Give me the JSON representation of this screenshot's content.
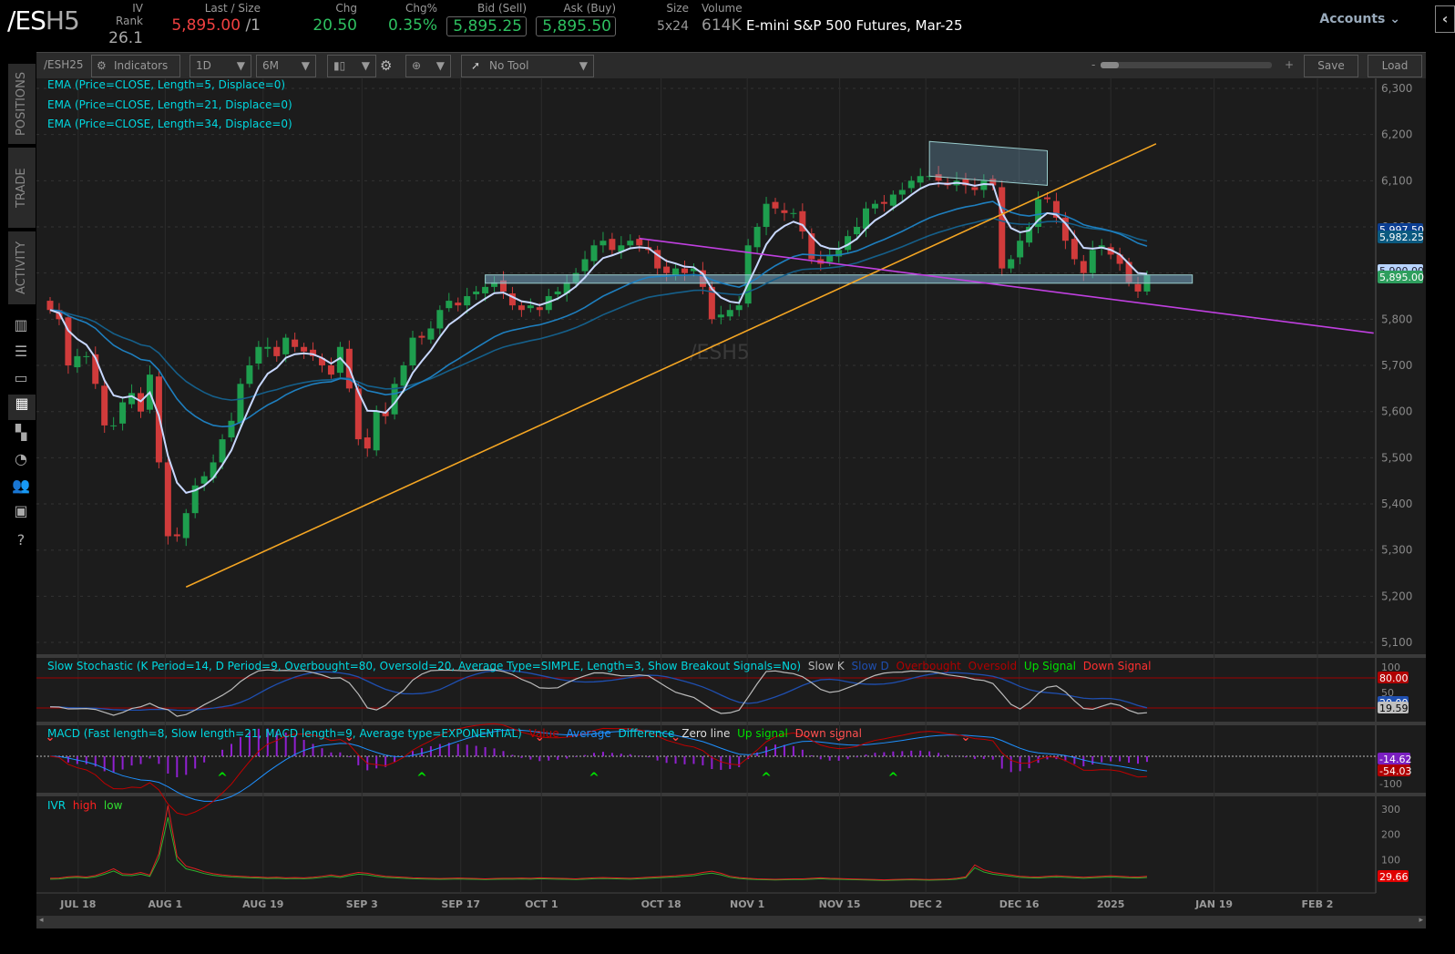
{
  "header": {
    "symbol_main": "/ES",
    "symbol_suffix": "H5",
    "iv_rank_label": "IV Rank",
    "iv_rank": "26.1",
    "last_label": "Last / Size",
    "last": "5,895.00",
    "last_size": "/1",
    "chg_label": "Chg",
    "chg": "20.50",
    "chgpct_label": "Chg%",
    "chgpct": "0.35%",
    "bid_label": "Bid (Sell)",
    "bid": "5,895.25",
    "ask_label": "Ask (Buy)",
    "ask": "5,895.50",
    "size_label": "Size",
    "size": "5x24",
    "volume_label": "Volume",
    "volume": "614K",
    "description": "E-mini S&P 500 Futures, Mar-25",
    "accounts": "Accounts"
  },
  "sidebar": {
    "tabs": [
      "POSITIONS",
      "TRADE",
      "ACTIVITY"
    ]
  },
  "toolbar": {
    "symbol": "/ESH25",
    "indicators": "Indicators",
    "aggregation": "1D",
    "timeframe": "6M",
    "drawing_tool": "No Tool",
    "zoom_minus": "-",
    "zoom_plus": "+",
    "save": "Save",
    "load": "Load",
    "zoom_level": 0.05
  },
  "colors": {
    "up": "#1e9e4e",
    "down": "#d03b3b",
    "ema5": "#c8d8ff",
    "ema21": "#1e7fbf",
    "ema34": "#155f8a",
    "trend": "#f5a623",
    "resistance": "#c040e0",
    "zone": "#7fb3d5"
  },
  "legends": {
    "ema": [
      "EMA (Price=CLOSE, Length=5, Displace=0)",
      "EMA (Price=CLOSE, Length=21, Displace=0)",
      "EMA (Price=CLOSE, Length=34, Displace=0)"
    ],
    "stoch": {
      "title": "Slow Stochastic (K Period=14, D Period=9, Overbought=80, Oversold=20, Average Type=SIMPLE, Length=3, Show Breakout Signals=No)",
      "items": [
        {
          "t": "Slow K",
          "c": "#bbbbbb"
        },
        {
          "t": "Slow D",
          "c": "#1f4fb0"
        },
        {
          "t": "Overbought",
          "c": "#b00000"
        },
        {
          "t": "Oversold",
          "c": "#b00000"
        },
        {
          "t": "Up Signal",
          "c": "#00e000"
        },
        {
          "t": "Down Signal",
          "c": "#ff3030"
        }
      ]
    },
    "macd": {
      "title": "MACD (Fast length=8, Slow length=21, MACD length=9, Average type=EXPONENTIAL)",
      "items": [
        {
          "t": "Value",
          "c": "#c00000"
        },
        {
          "t": "Average",
          "c": "#1e90ff"
        },
        {
          "t": "Difference",
          "c": "#00d8e0"
        },
        {
          "t": "Zero line",
          "c": "#dddddd"
        },
        {
          "t": "Up signal",
          "c": "#00e000"
        },
        {
          "t": "Down signal",
          "c": "#ff5050"
        }
      ]
    },
    "ivr": {
      "title": "IVR",
      "items": [
        {
          "t": "high",
          "c": "#ff2020"
        },
        {
          "t": "low",
          "c": "#30e030"
        }
      ]
    }
  },
  "watermark": "/ESH5",
  "chart_data": {
    "type": "candlestick",
    "closes": [
      5820,
      5800,
      5700,
      5720,
      5720,
      5660,
      5570,
      5570,
      5620,
      5640,
      5600,
      5680,
      5490,
      5330,
      5330,
      5380,
      5440,
      5460,
      5490,
      5540,
      5580,
      5660,
      5700,
      5740,
      5740,
      5720,
      5760,
      5740,
      5730,
      5720,
      5700,
      5680,
      5740,
      5650,
      5540,
      5520,
      5600,
      5590,
      5660,
      5700,
      5760,
      5760,
      5780,
      5820,
      5840,
      5830,
      5850,
      5860,
      5870,
      5880,
      5860,
      5830,
      5820,
      5830,
      5820,
      5850,
      5860,
      5880,
      5900,
      5930,
      5960,
      5970,
      5950,
      5960,
      5970,
      5960,
      5950,
      5910,
      5900,
      5910,
      5900,
      5910,
      5870,
      5800,
      5810,
      5820,
      5830,
      5960,
      6000,
      6050,
      6040,
      6030,
      6030,
      5990,
      5930,
      5920,
      5940,
      5950,
      5980,
      6000,
      6040,
      6050,
      6050,
      6070,
      6080,
      6100,
      6110,
      6110,
      6100,
      6090,
      6100,
      6090,
      6080,
      6100,
      6090,
      5910,
      5930,
      5970,
      6000,
      6060,
      6060,
      6020,
      5970,
      5930,
      5900,
      5950,
      5960,
      5940,
      5920,
      5880,
      5860,
      5895
    ],
    "ivr": [
      22,
      23,
      28,
      30,
      27,
      33,
      45,
      60,
      40,
      38,
      45,
      35,
      120,
      310,
      110,
      70,
      60,
      48,
      40,
      35,
      32,
      30,
      28,
      27,
      25,
      26,
      24,
      25,
      24,
      26,
      30,
      35,
      30,
      38,
      45,
      42,
      35,
      30,
      28,
      26,
      24,
      23,
      22,
      21,
      22,
      23,
      22,
      21,
      20,
      21,
      22,
      22,
      23,
      22,
      24,
      23,
      22,
      21,
      20,
      22,
      24,
      25,
      24,
      23,
      22,
      24,
      26,
      28,
      30,
      32,
      35,
      38,
      45,
      50,
      42,
      30,
      25,
      22,
      20,
      19,
      18,
      19,
      20,
      20,
      22,
      24,
      22,
      21,
      20,
      19,
      18,
      17,
      16,
      17,
      18,
      19,
      18,
      17,
      18,
      19,
      22,
      28,
      75,
      55,
      45,
      40,
      35,
      30,
      28,
      27,
      30,
      32,
      30,
      28,
      26,
      28,
      30,
      32,
      30,
      28,
      27,
      29.66
    ],
    "yaxis": {
      "min": 5100,
      "max": 6300,
      "ticks": [
        6300,
        6200,
        6100,
        6000,
        5900,
        5800,
        5700,
        5600,
        5500,
        5400,
        5300,
        5200,
        5100
      ]
    },
    "xticks": [
      {
        "label": "JUL 18",
        "bar": 3.1
      },
      {
        "label": "AUG 1",
        "bar": 12.7
      },
      {
        "label": "AUG 19",
        "bar": 23.5
      },
      {
        "label": "SEP 3",
        "bar": 34.4
      },
      {
        "label": "SEP 17",
        "bar": 45.3
      },
      {
        "label": "OCT 1",
        "bar": 54.2
      },
      {
        "label": "OCT 18",
        "bar": 67.4
      },
      {
        "label": "NOV 1",
        "bar": 76.9
      },
      {
        "label": "NOV 15",
        "bar": 87.1
      },
      {
        "label": "DEC 2",
        "bar": 96.6
      },
      {
        "label": "DEC 16",
        "bar": 106.9
      },
      {
        "label": "2025",
        "bar": 117
      },
      {
        "label": "JAN 19",
        "bar": 128.4
      },
      {
        "label": "FEB 2",
        "bar": 139.8
      }
    ],
    "price_bubbles": [
      {
        "label": "5,997.50",
        "c": "#0b3d91"
      },
      {
        "label": "5,982.25",
        "c": "#0b5a80"
      },
      {
        "label": "5,900.00",
        "c": "#b8d4ff"
      },
      {
        "label": "5,895.00",
        "c": "#2e9e5e"
      }
    ],
    "stoch_axis": [
      "100",
      "50"
    ],
    "stoch_bubbles": [
      {
        "label": "80.00",
        "c": "#b00000"
      },
      {
        "label": "20.00",
        "c": "#1f4fb0"
      },
      {
        "label": "19.59",
        "c": "#c0c0c0"
      }
    ],
    "macd_axis": [
      "-100"
    ],
    "macd_bubbles": [
      {
        "label": "-14.62",
        "c": "#7a1fc0"
      },
      {
        "label": "-54.03",
        "c": "#b00000"
      }
    ],
    "ivr_axis": [
      "300",
      "200",
      "100"
    ],
    "ivr_bubble": {
      "label": "29.66",
      "c": "#e00000"
    },
    "macd_down_signals": [
      0,
      33,
      54,
      69,
      87,
      101
    ],
    "macd_up_signals": [
      19,
      41,
      60,
      79,
      93
    ],
    "trendlines": [
      {
        "name": "support-trendline",
        "from": {
          "bar": 15,
          "price": 5220
        },
        "to": {
          "bar": 122,
          "price": 6180
        }
      },
      {
        "name": "resistance-trendline",
        "from": {
          "bar": 65,
          "price": 5975
        },
        "to": {
          "bar": 146,
          "price": 5770
        }
      }
    ],
    "zone": {
      "from_bar": 48,
      "to_bar": 126,
      "low": 5878,
      "high": 5896
    }
  }
}
